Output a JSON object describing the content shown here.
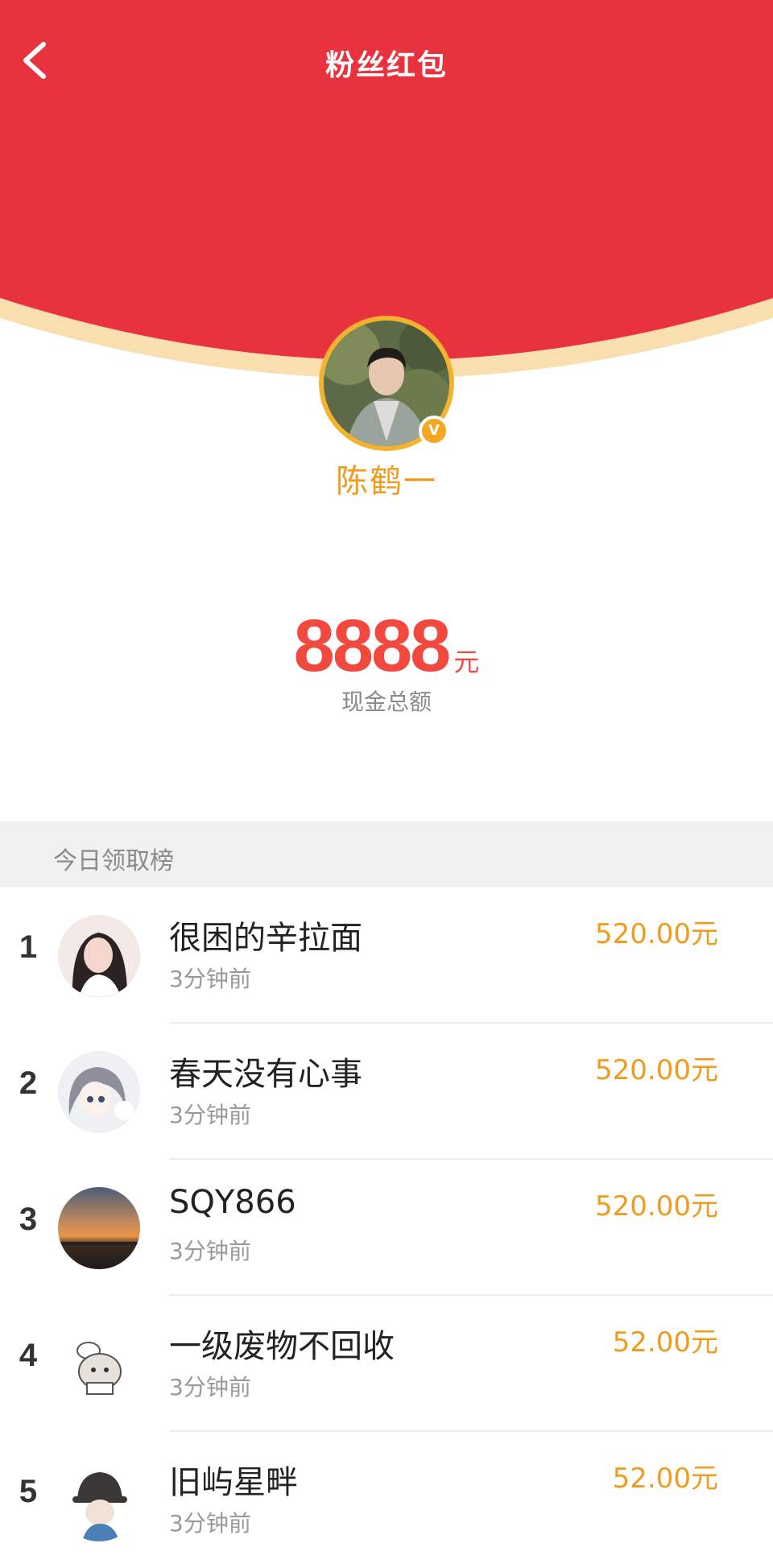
{
  "header": {
    "title": "粉丝红包"
  },
  "colors": {
    "red": "#e8333f",
    "gold": "#f4b32e",
    "orange": "#f19b1e",
    "amount_red": "#f2493f"
  },
  "owner": {
    "name": "陈鹤一",
    "badge": "V"
  },
  "summary": {
    "amount": "8888",
    "unit": "元",
    "caption": "现金总额"
  },
  "ranking": {
    "title": "今日领取榜",
    "items": [
      {
        "rank": "1",
        "name": "很困的辛拉面",
        "time": "3分钟前",
        "amount": "520.00元"
      },
      {
        "rank": "2",
        "name": "春天没有心事",
        "time": "3分钟前",
        "amount": "520.00元"
      },
      {
        "rank": "3",
        "name": "SQY866",
        "time": "3分钟前",
        "amount": "520.00元"
      },
      {
        "rank": "4",
        "name": "一级废物不回收",
        "time": "3分钟前",
        "amount": "52.00元"
      },
      {
        "rank": "5",
        "name": "旧屿星畔",
        "time": "3分钟前",
        "amount": "52.00元"
      }
    ]
  }
}
